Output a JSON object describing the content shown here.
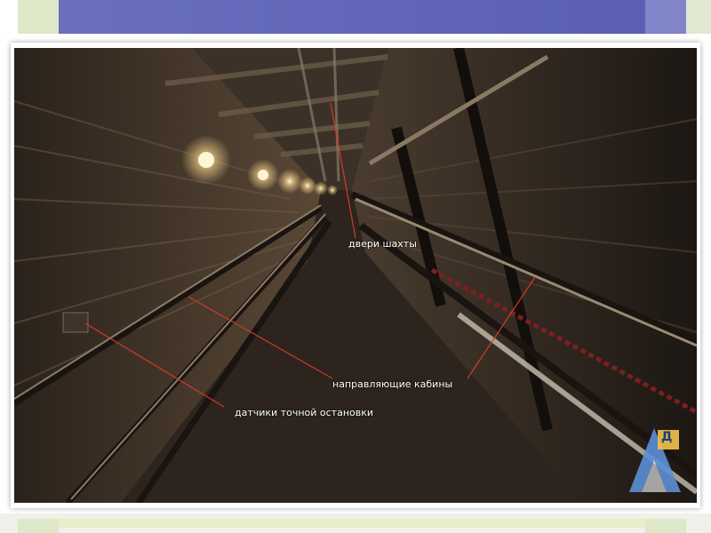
{
  "labels": {
    "shaft_doors": "двери шахты",
    "car_guides": "направляющие кабины",
    "stop_sensors": "датчики точной остановки"
  },
  "logo": {
    "letter": "Д",
    "icon": "triangle-a-logo"
  },
  "colors": {
    "header_band": "#6a6fbf",
    "accent_green": "#dde8c9",
    "callout_line": "#d23a2a",
    "logo_blue": "#5b8fd6"
  }
}
